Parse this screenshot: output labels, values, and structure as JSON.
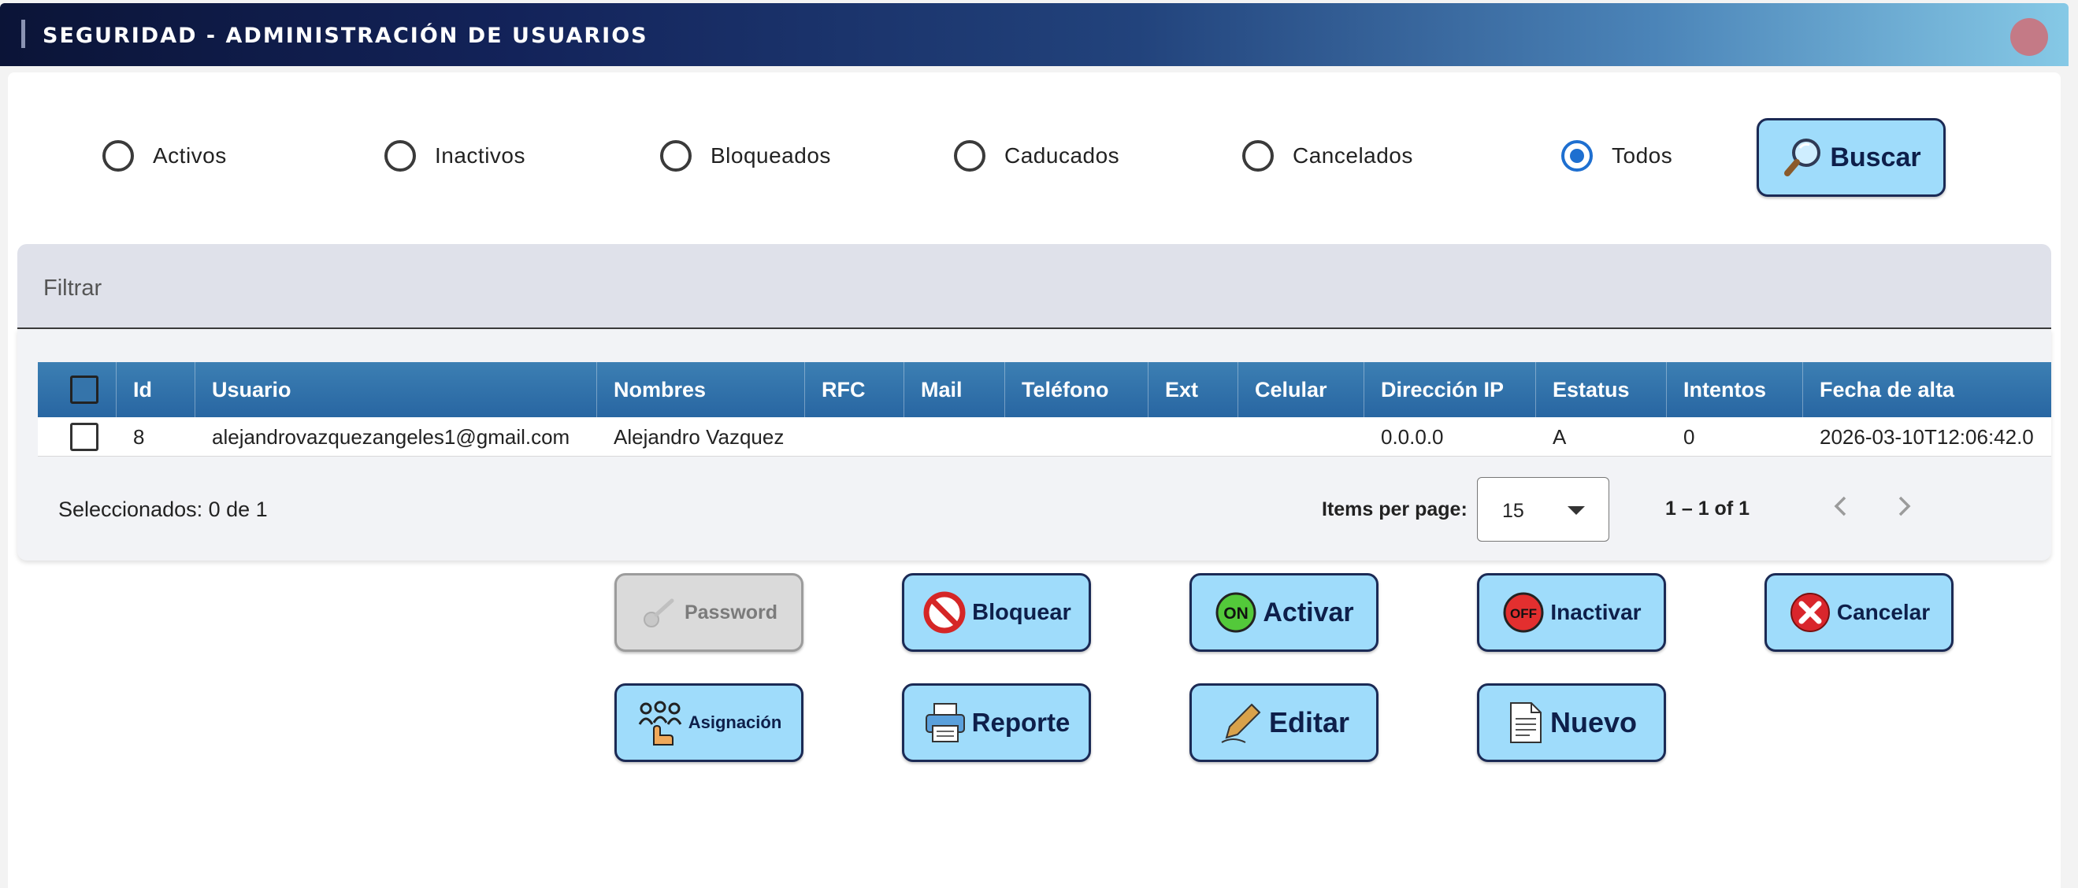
{
  "header": {
    "title": "SEGURIDAD - ADMINISTRACIÓN DE USUARIOS"
  },
  "status_filter": {
    "options": [
      "Activos",
      "Inactivos",
      "Bloqueados",
      "Caducados",
      "Cancelados",
      "Todos"
    ],
    "selected": "Todos",
    "search_label": "Buscar"
  },
  "filter": {
    "label": "Filtrar"
  },
  "table": {
    "columns": [
      "Id",
      "Usuario",
      "Nombres",
      "RFC",
      "Mail",
      "Teléfono",
      "Ext",
      "Celular",
      "Dirección IP",
      "Estatus",
      "Intentos",
      "Fecha de alta"
    ],
    "rows": [
      {
        "id": "8",
        "usuario": "alejandrovazquezangeles1@gmail.com",
        "nombres": "Alejandro Vazquez",
        "rfc": "",
        "mail": "",
        "telefono": "",
        "ext": "",
        "celular": "",
        "ip": "0.0.0.0",
        "estatus": "A",
        "intentos": "0",
        "fecha_alta": "2026-03-10T12:06:42.0"
      }
    ]
  },
  "footer": {
    "selected_text": "Seleccionados: 0 de 1",
    "items_per_page_label": "Items per page:",
    "items_per_page": "15",
    "range": "1 – 1 of 1"
  },
  "actions": {
    "password": "Password",
    "bloquear": "Bloquear",
    "activar": "Activar",
    "inactivar": "Inactivar",
    "cancelar": "Cancelar",
    "asignacion": "Asignación",
    "reporte": "Reporte",
    "editar": "Editar",
    "nuevo": "Nuevo"
  },
  "icons": {
    "on_badge": "ON",
    "off_badge": "OFF"
  },
  "colors": {
    "header_dark": "#0b1437",
    "button_bg": "#9fdcfb",
    "table_header": "#2866a2",
    "radio_selected": "#1e6fd0"
  }
}
